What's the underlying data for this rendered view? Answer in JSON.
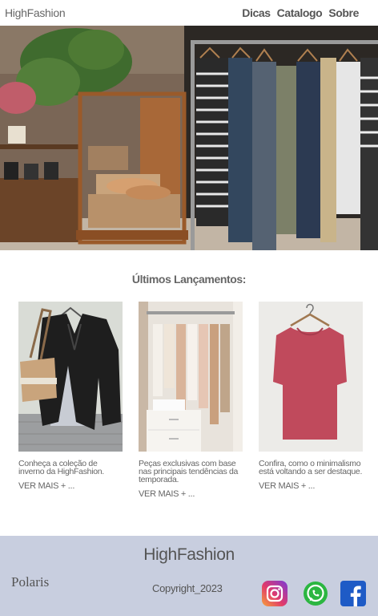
{
  "header": {
    "brand": "HighFashion",
    "nav": [
      "Dicas",
      "Catalogo",
      "Sobre"
    ]
  },
  "launches": {
    "title": "Últimos Lançamentos:",
    "cards": [
      {
        "description": "Conheça a coleção de inverno da HighFashion.",
        "link": "VER MAIS + ..."
      },
      {
        "description": "Peças exclusivas  com base nas principais tendências da temporada.",
        "link": "VER MAIS + ..."
      },
      {
        "description": "Confira, como o minimalismo está voltando a ser destaque.",
        "link": "VER MAIS + ..."
      }
    ]
  },
  "footer": {
    "brand": "HighFashion",
    "partner": "Polaris",
    "copyright": "Copyright_2023",
    "social": [
      "instagram-icon",
      "whatsapp-icon",
      "facebook-icon"
    ]
  }
}
